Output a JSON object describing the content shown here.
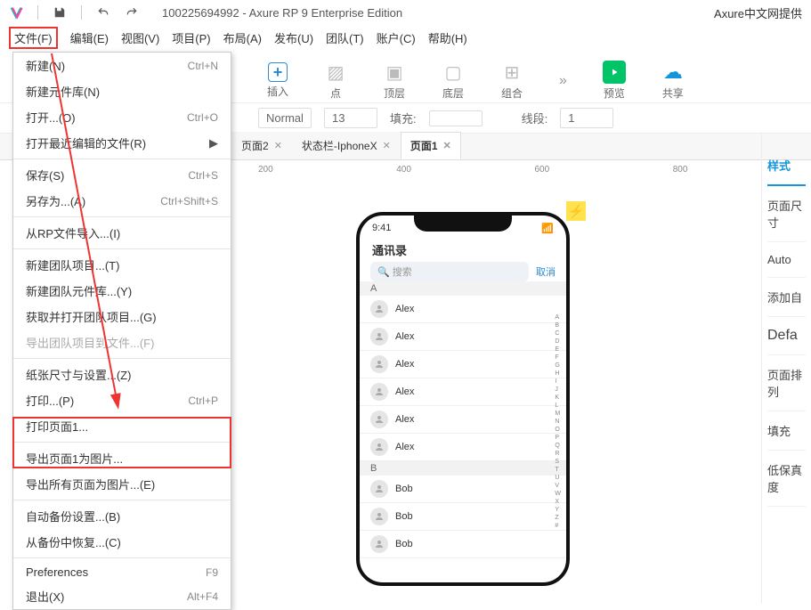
{
  "titlebar": {
    "doc_id": "100225694992",
    "app": "Axure RP 9 Enterprise Edition",
    "right": "Axure中文网提供"
  },
  "menubar": [
    "文件(F)",
    "编辑(E)",
    "视图(V)",
    "项目(P)",
    "布局(A)",
    "发布(U)",
    "团队(T)",
    "账户(C)",
    "帮助(H)"
  ],
  "toolbar": {
    "insert": "插入",
    "point": "点",
    "top": "顶层",
    "bottom": "底层",
    "group": "组合",
    "preview": "预览",
    "share": "共享"
  },
  "propbar": {
    "style": "Normal",
    "size": "13",
    "fill_lbl": "填充:",
    "line_lbl": "线段:",
    "line_val": "1"
  },
  "tabs": [
    {
      "label": "页面2",
      "active": false
    },
    {
      "label": "状态栏-IphoneX",
      "active": false
    },
    {
      "label": "页面1",
      "active": true
    }
  ],
  "ruler": [
    "200",
    "400",
    "600",
    "800"
  ],
  "dropdown": [
    {
      "label": "新建(N)",
      "shortcut": "Ctrl+N"
    },
    {
      "label": "新建元件库(N)"
    },
    {
      "label": "打开...(O)",
      "shortcut": "Ctrl+O"
    },
    {
      "label": "打开最近编辑的文件(R)",
      "sub": true
    },
    {
      "sep": true
    },
    {
      "label": "保存(S)",
      "shortcut": "Ctrl+S"
    },
    {
      "label": "另存为...(A)",
      "shortcut": "Ctrl+Shift+S"
    },
    {
      "sep": true
    },
    {
      "label": "从RP文件导入...(I)"
    },
    {
      "sep": true
    },
    {
      "label": "新建团队项目...(T)"
    },
    {
      "label": "新建团队元件库...(Y)"
    },
    {
      "label": "获取并打开团队项目...(G)"
    },
    {
      "label": "导出团队项目到文件...(F)",
      "disabled": true
    },
    {
      "sep": true
    },
    {
      "label": "纸张尺寸与设置...(Z)"
    },
    {
      "label": "打印...(P)",
      "shortcut": "Ctrl+P"
    },
    {
      "label": "打印页面1..."
    },
    {
      "sep": true
    },
    {
      "label": "导出页面1为图片..."
    },
    {
      "label": "导出所有页面为图片...(E)"
    },
    {
      "sep": true
    },
    {
      "label": "自动备份设置...(B)"
    },
    {
      "label": "从备份中恢复...(C)"
    },
    {
      "sep": true
    },
    {
      "label": "Preferences",
      "shortcut": "F9"
    },
    {
      "label": "退出(X)",
      "shortcut": "Alt+F4"
    }
  ],
  "phone": {
    "time": "9:41",
    "title": "通讯录",
    "search": "搜索",
    "cancel": "取消",
    "sections": [
      {
        "h": "A",
        "rows": [
          "Alex",
          "Alex",
          "Alex",
          "Alex",
          "Alex",
          "Alex"
        ]
      },
      {
        "h": "B",
        "rows": [
          "Bob",
          "Bob",
          "Bob"
        ]
      }
    ],
    "index": [
      "A",
      "B",
      "C",
      "D",
      "E",
      "F",
      "G",
      "H",
      "I",
      "J",
      "K",
      "L",
      "M",
      "N",
      "O",
      "P",
      "Q",
      "R",
      "S",
      "T",
      "U",
      "V",
      "W",
      "X",
      "Y",
      "Z",
      "#"
    ]
  },
  "rightpanel": [
    "样式",
    "页面尺寸",
    "Auto",
    "添加自",
    "Defa",
    "页面排列",
    "填充",
    "低保真度"
  ]
}
